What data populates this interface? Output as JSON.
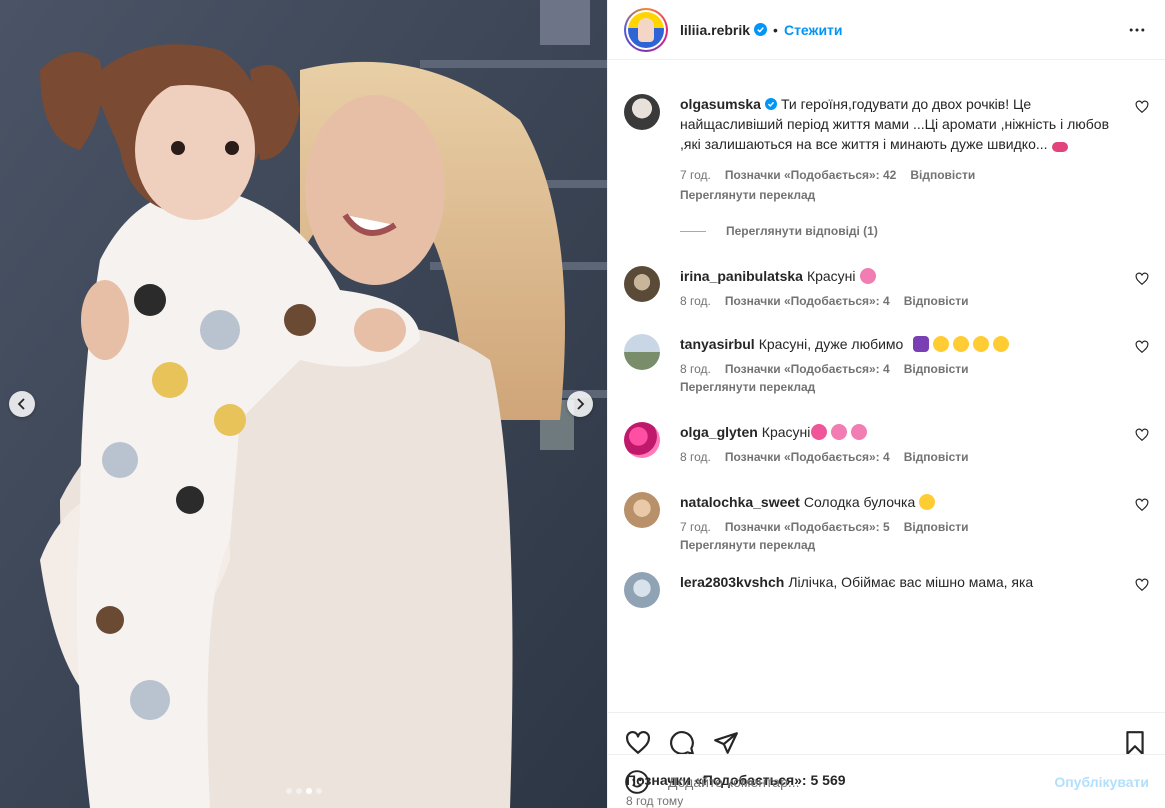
{
  "post": {
    "author": "liliia.rebrik",
    "follow_label": "Стежити",
    "separator": "•",
    "likes_text": "Позначки «Подобається»: 5 569",
    "time_ago": "8 год тому"
  },
  "carousel": {
    "prev_icon": "chevron-left-icon",
    "next_icon": "chevron-right-icon",
    "total": 4,
    "active_index": 3
  },
  "comments": [
    {
      "user": "olgasumska",
      "verified": true,
      "text": "Ти героїня,годувати до двох рочків! Це найщасливіший період життя мами ...Ці аромати ,ніжність і любов ,які залишаються на все життя і минають дуже швидко...",
      "emoji": [
        "kiss-lips"
      ],
      "time": "7 год.",
      "likes": "Позначки «Подобається»: 42",
      "reply": "Відповісти",
      "translate": "Переглянути переклад",
      "view_replies": "Переглянути відповіді (1)"
    },
    {
      "user": "irina_panibulatska",
      "text": "Красуні",
      "emoji": [
        "flower"
      ],
      "time": "8 год.",
      "likes": "Позначки «Подобається»: 4",
      "reply": "Відповісти"
    },
    {
      "user": "tanyasirbul",
      "text": "Красуні, дуже любимо",
      "emoji": [
        "grapes",
        "heart-eyes",
        "heart-eyes",
        "heart-eyes",
        "heart-eyes"
      ],
      "time": "8 год.",
      "likes": "Позначки «Подобається»: 4",
      "reply": "Відповісти",
      "translate": "Переглянути переклад"
    },
    {
      "user": "olga_glyten",
      "text": "Красуні",
      "emoji": [
        "two-hearts",
        "flower",
        "flower"
      ],
      "time": "8 год.",
      "likes": "Позначки «Подобається»: 4",
      "reply": "Відповісти"
    },
    {
      "user": "natalochka_sweet",
      "text": "Солодка булочка",
      "emoji": [
        "heart-eyes"
      ],
      "time": "7 год.",
      "likes": "Позначки «Подобається»: 5",
      "reply": "Відповісти",
      "translate": "Переглянути переклад"
    },
    {
      "user": "lera2803kvshch",
      "text": "Лілічка, Обіймає вас мішно мама, яка"
    }
  ],
  "composer": {
    "placeholder": "Додайте коментар...",
    "publish_label": "Опублікувати"
  },
  "colors": {
    "accent": "#0095f6",
    "publish_disabled": "#b2dffc",
    "muted": "#737373",
    "border": "#efefef"
  }
}
